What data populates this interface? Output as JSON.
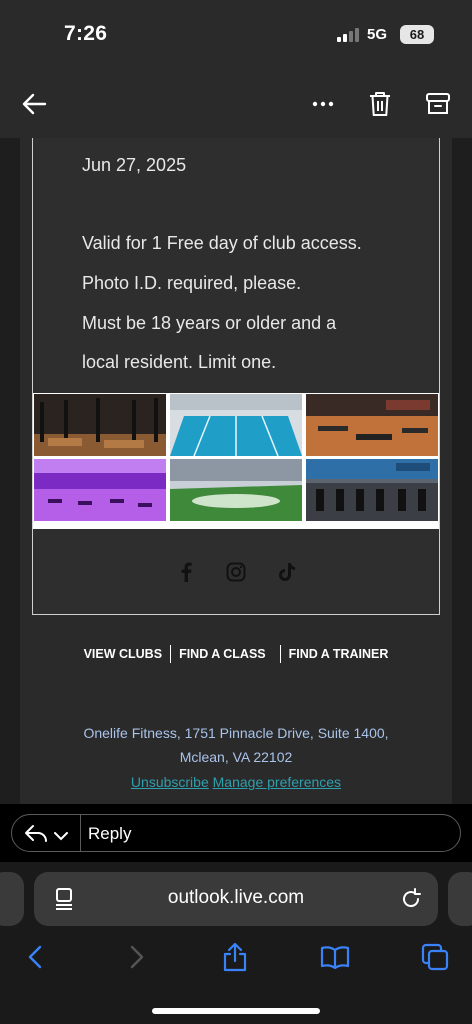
{
  "status": {
    "time": "7:26",
    "network": "5G",
    "battery": "68"
  },
  "email": {
    "date": "Jun 27, 2025",
    "lines": [
      "Valid for 1 Free day of club access.",
      "Photo I.D. required, please.",
      "Must be 18 years or older and a",
      "local resident. Limit one."
    ],
    "footer_links": [
      "VIEW CLUBS",
      "FIND A CLASS",
      "FIND A TRAINER"
    ],
    "address_line1": "Onelife Fitness, 1751 Pinnacle Drive, Suite 1400,",
    "address_line2": "Mclean, VA 22102",
    "unsubscribe": "Unsubscribe",
    "manage_preferences": "Manage preferences"
  },
  "reply": {
    "label": "Reply"
  },
  "browser": {
    "url": "outlook.live.com"
  },
  "icons": {
    "back": "back-arrow-icon",
    "more": "more-icon",
    "trash": "trash-icon",
    "archive": "archive-icon",
    "facebook": "facebook-icon",
    "instagram": "instagram-icon",
    "tiktok": "tiktok-icon"
  },
  "colors": {
    "link": "#2e9fae",
    "address": "#a9c3ea",
    "ios_blue": "#3a82f7"
  }
}
